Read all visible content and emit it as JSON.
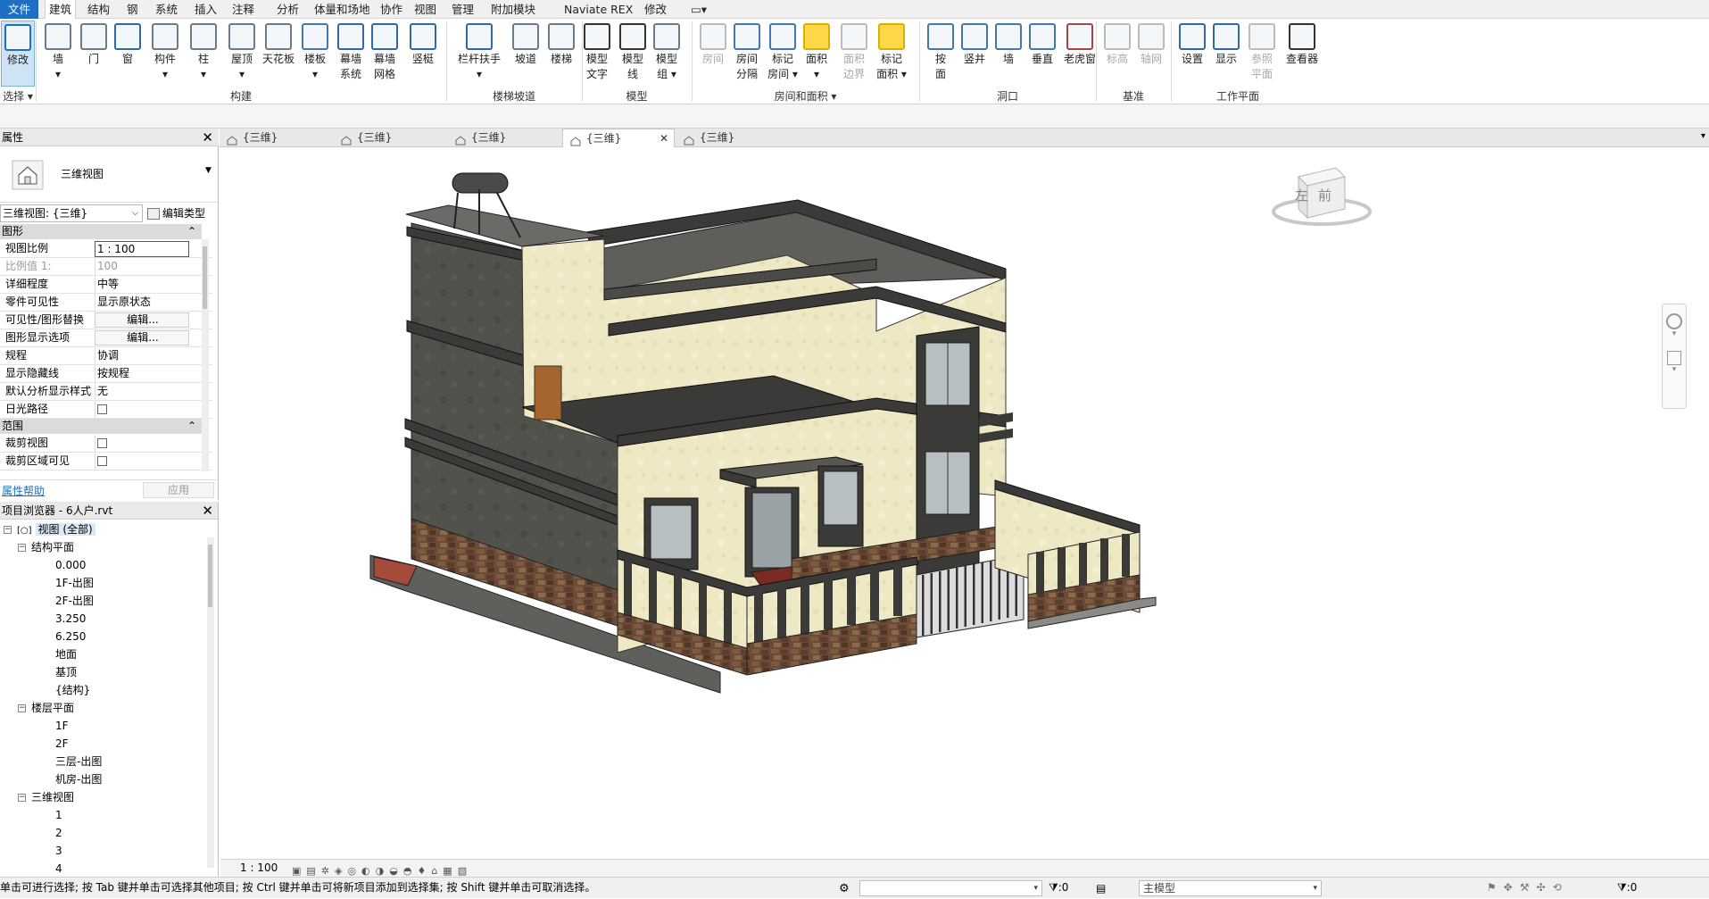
{
  "menu": [
    "文件",
    "建筑",
    "结构",
    "钢",
    "系统",
    "插入",
    "注释",
    "分析",
    "体量和场地",
    "协作",
    "视图",
    "管理",
    "附加模块",
    "Naviate REX",
    "修改",
    "▭▾"
  ],
  "ribbon": {
    "tools": [
      {
        "l1": "修改",
        "l2": ""
      },
      {
        "l1": "墙",
        "l2": "▾"
      },
      {
        "l1": "门",
        "l2": ""
      },
      {
        "l1": "窗",
        "l2": ""
      },
      {
        "l1": "构件",
        "l2": "▾"
      },
      {
        "l1": "柱",
        "l2": "▾"
      },
      {
        "l1": "屋顶",
        "l2": "▾"
      },
      {
        "l1": "天花板",
        "l2": ""
      },
      {
        "l1": "楼板",
        "l2": "▾"
      },
      {
        "l1": "幕墙",
        "l2": "系统"
      },
      {
        "l1": "幕墙",
        "l2": "网格"
      },
      {
        "l1": "竖梃",
        "l2": ""
      },
      {
        "l1": "栏杆扶手",
        "l2": "▾"
      },
      {
        "l1": "坡道",
        "l2": ""
      },
      {
        "l1": "楼梯",
        "l2": ""
      },
      {
        "l1": "模型",
        "l2": "文字"
      },
      {
        "l1": "模型",
        "l2": "线"
      },
      {
        "l1": "模型",
        "l2": "组 ▾"
      },
      {
        "l1": "房间",
        "l2": ""
      },
      {
        "l1": "房间",
        "l2": "分隔"
      },
      {
        "l1": "标记",
        "l2": "房间 ▾"
      },
      {
        "l1": "面积",
        "l2": "▾"
      },
      {
        "l1": "面积",
        "l2": "边界"
      },
      {
        "l1": "标记",
        "l2": "面积 ▾"
      },
      {
        "l1": "按",
        "l2": "面"
      },
      {
        "l1": "竖井",
        "l2": ""
      },
      {
        "l1": "墙",
        "l2": ""
      },
      {
        "l1": "垂直",
        "l2": ""
      },
      {
        "l1": "老虎窗",
        "l2": ""
      },
      {
        "l1": "标高",
        "l2": ""
      },
      {
        "l1": "轴网",
        "l2": ""
      },
      {
        "l1": "设置",
        "l2": ""
      },
      {
        "l1": "显示",
        "l2": ""
      },
      {
        "l1": "参照",
        "l2": "平面"
      },
      {
        "l1": "查看器",
        "l2": ""
      }
    ],
    "groups": [
      "选择 ▾",
      "构建",
      "楼梯坡道",
      "模型",
      "房间和面积 ▾",
      "洞口",
      "基准",
      "工作平面"
    ]
  },
  "properties": {
    "title": "属性",
    "type_name": "三维视图",
    "view_selector": "三维视图: {三维}",
    "edit_type": "编辑类型",
    "section_graphics": "图形",
    "section_extents": "范围",
    "rows": [
      {
        "k": "视图比例",
        "v": "1 : 100"
      },
      {
        "k": "比例值 1:",
        "v": "100"
      },
      {
        "k": "详细程度",
        "v": "中等"
      },
      {
        "k": "零件可见性",
        "v": "显示原状态"
      },
      {
        "k": "可见性/图形替换",
        "v": "编辑..."
      },
      {
        "k": "图形显示选项",
        "v": "编辑..."
      },
      {
        "k": "规程",
        "v": "协调"
      },
      {
        "k": "显示隐藏线",
        "v": "按规程"
      },
      {
        "k": "默认分析显示样式",
        "v": "无"
      },
      {
        "k": "日光路径",
        "v": ""
      },
      {
        "k": "裁剪视图",
        "v": ""
      },
      {
        "k": "裁剪区域可见",
        "v": ""
      }
    ],
    "help": "属性帮助",
    "apply": "应用"
  },
  "browser": {
    "title": "项目浏览器 - 6人户.rvt",
    "items": [
      {
        "t": "视图 (全部)",
        "lvl": 0,
        "tog": "−",
        "sel": true
      },
      {
        "t": "结构平面",
        "lvl": 1,
        "tog": "−"
      },
      {
        "t": "0.000",
        "lvl": 2,
        "tog": ""
      },
      {
        "t": "1F-出图",
        "lvl": 2,
        "tog": ""
      },
      {
        "t": "2F-出图",
        "lvl": 2,
        "tog": ""
      },
      {
        "t": "3.250",
        "lvl": 2,
        "tog": ""
      },
      {
        "t": "6.250",
        "lvl": 2,
        "tog": ""
      },
      {
        "t": "地面",
        "lvl": 2,
        "tog": ""
      },
      {
        "t": "基顶",
        "lvl": 2,
        "tog": ""
      },
      {
        "t": "{结构}",
        "lvl": 2,
        "tog": ""
      },
      {
        "t": "楼层平面",
        "lvl": 1,
        "tog": "−"
      },
      {
        "t": "1F",
        "lvl": 2,
        "tog": ""
      },
      {
        "t": "2F",
        "lvl": 2,
        "tog": ""
      },
      {
        "t": "三层-出图",
        "lvl": 2,
        "tog": ""
      },
      {
        "t": "机房-出图",
        "lvl": 2,
        "tog": ""
      },
      {
        "t": "三维视图",
        "lvl": 1,
        "tog": "−"
      },
      {
        "t": "1",
        "lvl": 2,
        "tog": ""
      },
      {
        "t": "2",
        "lvl": 2,
        "tog": ""
      },
      {
        "t": "3",
        "lvl": 2,
        "tog": ""
      },
      {
        "t": "4",
        "lvl": 2,
        "tog": ""
      }
    ]
  },
  "tabs": [
    {
      "label": "{三维}",
      "active": false
    },
    {
      "label": "{三维}",
      "active": false
    },
    {
      "label": "{三维}",
      "active": false
    },
    {
      "label": "{三维}",
      "active": true
    },
    {
      "label": "{三维}",
      "active": false
    }
  ],
  "viewcube": {
    "left": "左",
    "front": "前"
  },
  "view_bar": {
    "scale": "1 : 100"
  },
  "status": {
    "message": "单击可进行选择; 按 Tab 键并单击可选择其他项目; 按 Ctrl 键并单击可将新项目添加到选择集; 按 Shift 键并单击可取消选择。",
    "sel_count": ":0",
    "model": "主模型",
    "filter": ":0"
  },
  "colors": {
    "accent": "#1e6fc4",
    "wall_cream": "#efe8c4",
    "wall_dark": "#4d4d4a",
    "stone": "#6b4a36",
    "door": "#a5652d"
  }
}
